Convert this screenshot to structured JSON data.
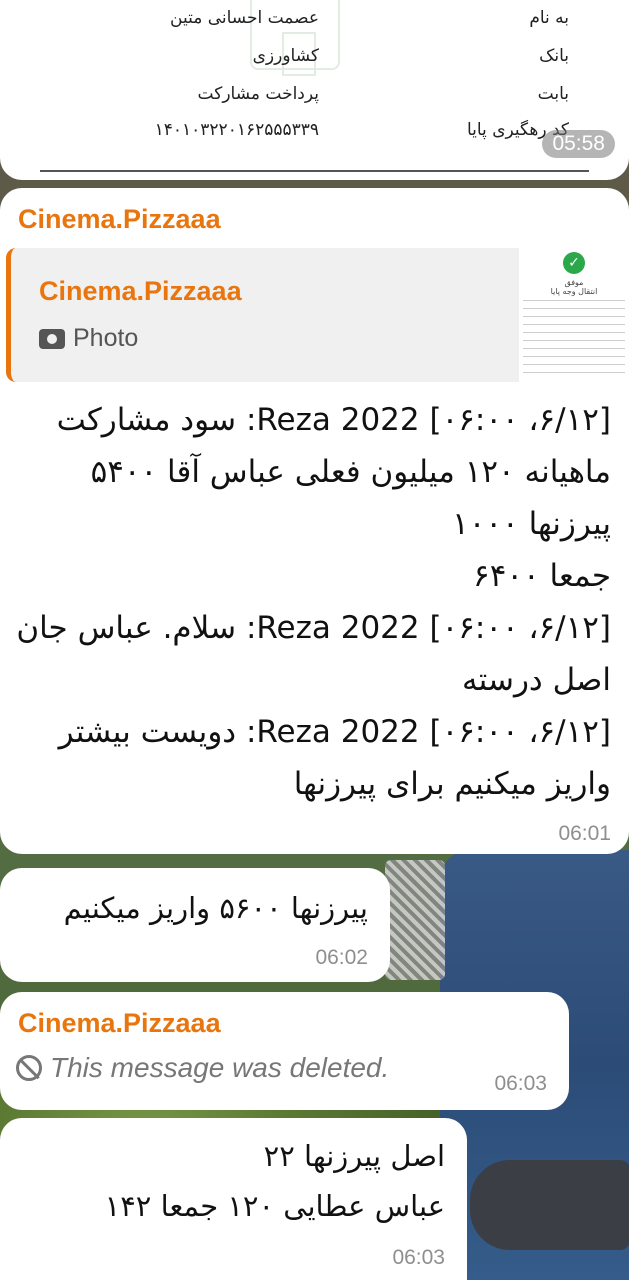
{
  "receipt": {
    "rows": [
      {
        "label": "به نام",
        "value": "عصمت احسانی متین"
      },
      {
        "label": "بانک",
        "value": "کشاورزی"
      },
      {
        "label": "بابت",
        "value": "پرداخت مشارکت"
      },
      {
        "label": "کد رهگیری پایا",
        "value": "۱۴۰۱۰۳۲۲۰۱۶۲۵۵۵۳۳۹"
      }
    ],
    "time": "05:58"
  },
  "message_main": {
    "sender": "Cinema.Pizzaaa",
    "reply": {
      "name": "Cinema.Pizzaaa",
      "type": "Photo",
      "thumb_title": "انتقال وجه پایا",
      "thumb_status": "موفق"
    },
    "lines": [
      "[۶/۱۲، ۰۶:۰۰] Reza 2022: سود مشارکت ماهیانه ۱۲۰ میلیون فعلی عباس آقا ۵۴۰۰ پیرزنها ۱۰۰۰",
      "جمعا ۶۴۰۰",
      "[۶/۱۲، ۰۶:۰۰] Reza 2022: سلام. عباس جان اصل درسته",
      "[۶/۱۲، ۰۶:۰۰] Reza 2022: دویست بیشتر واریز میکنیم برای پیرزنها"
    ],
    "time": "06:01"
  },
  "message_2": {
    "text": "پیرزنها ۵۶۰۰ واریز میکنیم",
    "time": "06:02"
  },
  "message_3": {
    "sender": "Cinema.Pizzaaa",
    "text": "This message was deleted.",
    "time": "06:03"
  },
  "message_4": {
    "lines": [
      "اصل پیرزنها ۲۲",
      "عباس عطایی ۱۲۰ جمعا ۱۴۲"
    ],
    "time": "06:03"
  }
}
